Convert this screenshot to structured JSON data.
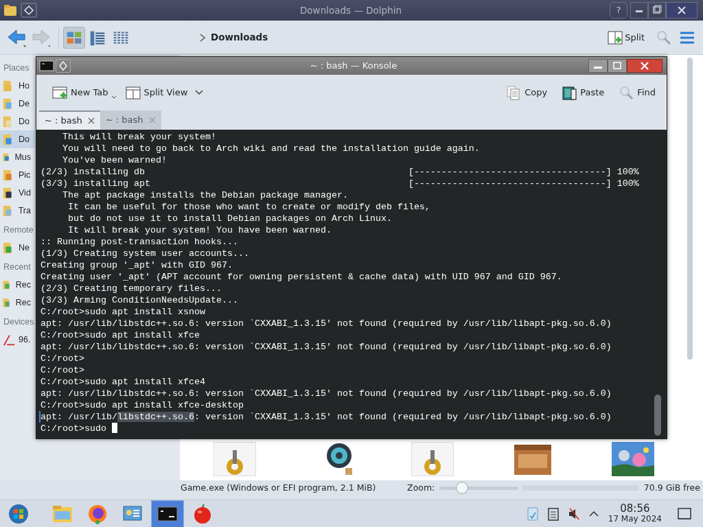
{
  "dolphin": {
    "title": "Downloads — Dolphin",
    "help_button": "?",
    "view_modes": [
      {
        "kind": "icons",
        "selected": true
      },
      {
        "kind": "compact",
        "selected": false
      },
      {
        "kind": "details",
        "selected": false
      }
    ],
    "breadcrumb": "Downloads",
    "split_button": "Split",
    "places": [
      {
        "kind": "heading",
        "label": "Places"
      },
      {
        "kind": "item",
        "label": "Ho",
        "selected": false
      },
      {
        "kind": "item",
        "label": "De",
        "selected": false
      },
      {
        "kind": "item",
        "label": "Do",
        "selected": false
      },
      {
        "kind": "item",
        "label": "Do",
        "selected": true
      },
      {
        "kind": "item",
        "label": "Mus",
        "selected": false
      },
      {
        "kind": "item",
        "label": "Pic",
        "selected": false
      },
      {
        "kind": "item",
        "label": "Vid",
        "selected": false
      },
      {
        "kind": "item",
        "label": "Tra",
        "selected": false
      },
      {
        "kind": "heading",
        "label": "Remote"
      },
      {
        "kind": "item",
        "label": "Ne",
        "selected": false
      },
      {
        "kind": "heading",
        "label": "Recent"
      },
      {
        "kind": "item",
        "label": "Rec",
        "selected": false
      },
      {
        "kind": "item",
        "label": "Rec",
        "selected": false
      },
      {
        "kind": "heading",
        "label": "Devices"
      },
      {
        "kind": "device",
        "label": "96.",
        "selected": false
      }
    ],
    "files": [
      {
        "kind": "gear"
      },
      {
        "kind": "disc"
      },
      {
        "kind": "gear"
      },
      {
        "kind": "crate"
      },
      {
        "kind": "picture"
      }
    ],
    "status": {
      "text": "Game.exe (Windows or EFI program, 2.1 MiB)",
      "zoom_label": "Zoom:",
      "zoom": {
        "level": 0.29
      },
      "free_space": {
        "text": "70.9 GiB free"
      }
    }
  },
  "konsole": {
    "title": "~ : bash — Konsole",
    "toolbar_left": [
      {
        "kind": "new-tab",
        "label": "New Tab"
      },
      {
        "kind": "split",
        "label": "Split View"
      }
    ],
    "toolbar_right": [
      {
        "kind": "copy",
        "label": "Copy"
      },
      {
        "kind": "paste",
        "label": "Paste"
      },
      {
        "kind": "find",
        "label": "Find"
      }
    ],
    "tabs": [
      {
        "label": "~ : bash",
        "selected": true
      },
      {
        "label": "~ : bash",
        "selected": false
      }
    ],
    "lines": [
      {
        "text": "    This will break your system!"
      },
      {
        "text": "    You will need to go back to Arch wiki and read the installation guide again."
      },
      {
        "text": "    You've been warned!"
      },
      {
        "text": "(2/3) installing db                                                [-----------------------------------] 100%"
      },
      {
        "text": "(3/3) installing apt                                               [-----------------------------------] 100%"
      },
      {
        "text": "    The apt package installs the Debian package manager."
      },
      {
        "text": "     It can be useful for those who want to create or modify deb files,"
      },
      {
        "text": "     but do not use it to install Debian packages on Arch Linux."
      },
      {
        "text": "     It will break your system! You have been warned."
      },
      {
        "text": ":: Running post-transaction hooks..."
      },
      {
        "text": "(1/3) Creating system user accounts..."
      },
      {
        "text": "Creating group '_apt' with GID 967."
      },
      {
        "text": "Creating user '_apt' (APT account for owning persistent & cache data) with UID 967 and GID 967."
      },
      {
        "text": "(2/3) Creating temporary files..."
      },
      {
        "text": "(3/3) Arming ConditionNeedsUpdate..."
      },
      {
        "text": "C:/root>sudo apt install xsnow"
      },
      {
        "text": "apt: /usr/lib/libstdc++.so.6: version `CXXABI_1.3.15' not found (required by /usr/lib/libapt-pkg.so.6.0)"
      },
      {
        "text": "C:/root>sudo apt install xfce"
      },
      {
        "text": "apt: /usr/lib/libstdc++.so.6: version `CXXABI_1.3.15' not found (required by /usr/lib/libapt-pkg.so.6.0)"
      },
      {
        "text": "C:/root>"
      },
      {
        "text": "C:/root>"
      },
      {
        "text": "C:/root>sudo apt install xfce4"
      },
      {
        "text": "apt: /usr/lib/libstdc++.so.6: version `CXXABI_1.3.15' not found (required by /usr/lib/libapt-pkg.so.6.0)"
      },
      {
        "text": "C:/root>sudo apt install xfce-desktop"
      },
      {
        "segments": [
          {
            "text": "apt: /usr/lib/",
            "selected": false
          },
          {
            "text": "libstdc++.so.6",
            "selected": true
          },
          {
            "text": ": version `CXXABI_1.3.15' not found (required by /usr/lib/libapt-pkg.so.6.0)",
            "selected": false
          }
        ]
      },
      {
        "text": "C:/root>sudo",
        "cursor": true
      }
    ]
  },
  "taskbar": {
    "apps": [
      {
        "kind": "start",
        "selected": false
      },
      {
        "kind": "folder",
        "selected": false
      },
      {
        "kind": "browser",
        "selected": false
      },
      {
        "kind": "settings",
        "selected": false
      },
      {
        "kind": "terminal",
        "selected": true
      },
      {
        "kind": "apple",
        "selected": false
      }
    ],
    "time": "08:56",
    "date": "17 May 2024"
  }
}
